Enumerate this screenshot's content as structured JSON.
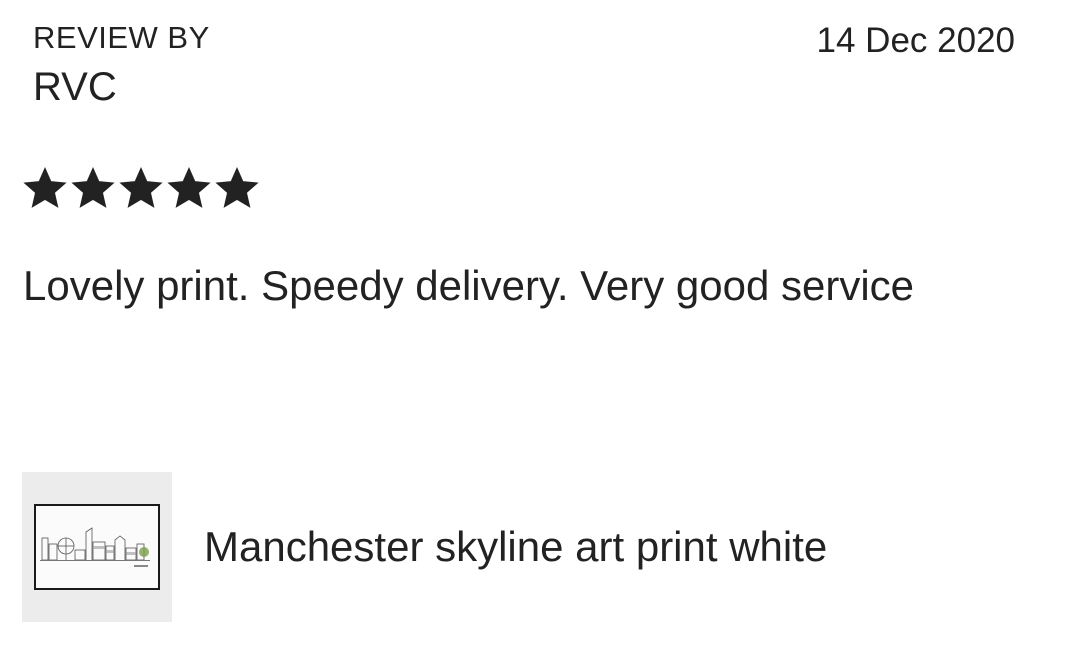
{
  "review": {
    "by_label": "REVIEW BY",
    "reviewer": "RVC",
    "date": "14 Dec 2020",
    "rating": 5,
    "rating_max": 5,
    "text": "Lovely print. Speedy delivery. Very good service"
  },
  "product": {
    "title": "Manchester skyline art print white",
    "thumbnail_icon": "framed-skyline-print-thumbnail"
  },
  "colors": {
    "text": "#222222",
    "star": "#222222",
    "thumb_bg": "#ececec",
    "frame": "#1a1a1a"
  }
}
